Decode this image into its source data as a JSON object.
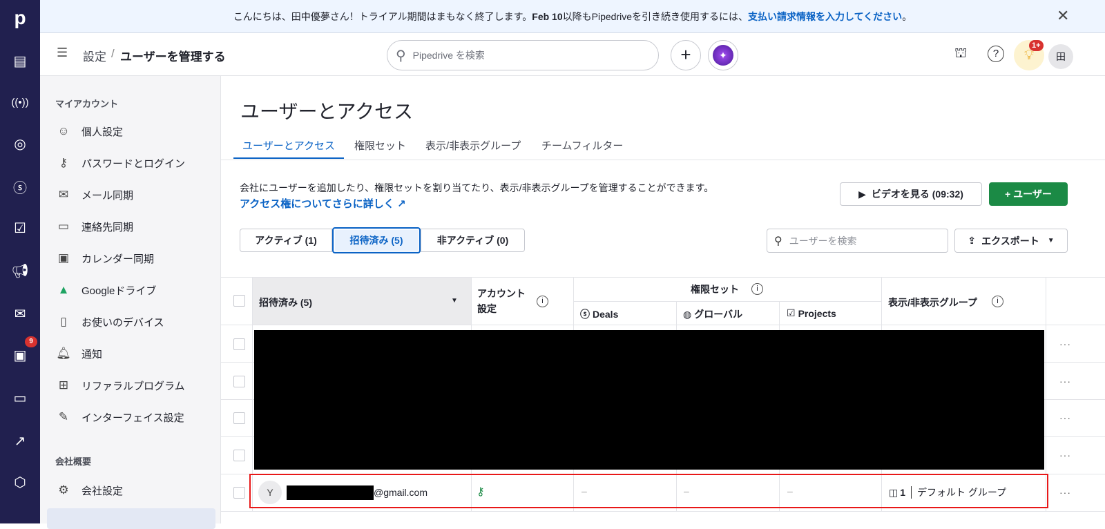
{
  "banner": {
    "text_before": "こんにちは、田中優夢さん！トライアル期間はまもなく終了します。",
    "text_bold": "Feb 10",
    "text_mid": "以降もPipedriveを引き続き使用するには、",
    "link": "支払い請求情報を入力してください",
    "text_end": "。"
  },
  "nav": {
    "logo": "p",
    "badge": "9"
  },
  "header": {
    "breadcrumb_parent": "設定",
    "breadcrumb_sep": "/",
    "breadcrumb_current": "ユーザーを管理する",
    "search_placeholder": "Pipedrive を検索",
    "tips_badge": "1+",
    "avatar": "田"
  },
  "sidebar": {
    "section1": "マイアカウント",
    "items": [
      {
        "icon": "face-icon",
        "label": "個人設定"
      },
      {
        "icon": "key-icon",
        "label": "パスワードとログイン"
      },
      {
        "icon": "mail-icon",
        "label": "メール同期"
      },
      {
        "icon": "contact-card-icon",
        "label": "連絡先同期"
      },
      {
        "icon": "calendar-icon",
        "label": "カレンダー同期"
      },
      {
        "icon": "google-drive-icon",
        "label": "Googleドライブ"
      },
      {
        "icon": "device-icon",
        "label": "お使いのデバイス"
      },
      {
        "icon": "bell-icon",
        "label": "通知"
      },
      {
        "icon": "gift-icon",
        "label": "リファラルプログラム"
      },
      {
        "icon": "interface-icon",
        "label": "インターフェイス設定"
      }
    ],
    "section2": "会社概要",
    "company_items": [
      {
        "icon": "gear-icon",
        "label": "会社設定"
      }
    ]
  },
  "main": {
    "title": "ユーザーとアクセス",
    "tabs": [
      "ユーザーとアクセス",
      "権限セット",
      "表示/非表示グループ",
      "チームフィルター"
    ],
    "description": "会社にユーザーを追加したり、権限セットを割り当てたり、表示/非表示グループを管理することができます。",
    "learn_more": "アクセス権についてさらに詳しく ↗",
    "video_button": "ビデオを見る (09:32)",
    "add_user_button": "+ ユーザー",
    "filters": [
      "アクティブ (1)",
      "招待済み (5)",
      "非アクティブ (0)"
    ],
    "user_search_placeholder": "ユーザーを検索",
    "export_button": "エクスポート"
  },
  "table": {
    "name_header": "招待済み (5)",
    "account_header": "アカウント設定",
    "permission_header": "権限セット",
    "deals": "Deals",
    "global": "グローバル",
    "projects": "Projects",
    "group_header": "表示/非表示グループ",
    "row": {
      "avatar": "Y",
      "email_suffix": "@gmail.com",
      "deals": "–",
      "global": "–",
      "projects": "–",
      "group_count": "1",
      "group_name": "デフォルト グループ"
    }
  }
}
